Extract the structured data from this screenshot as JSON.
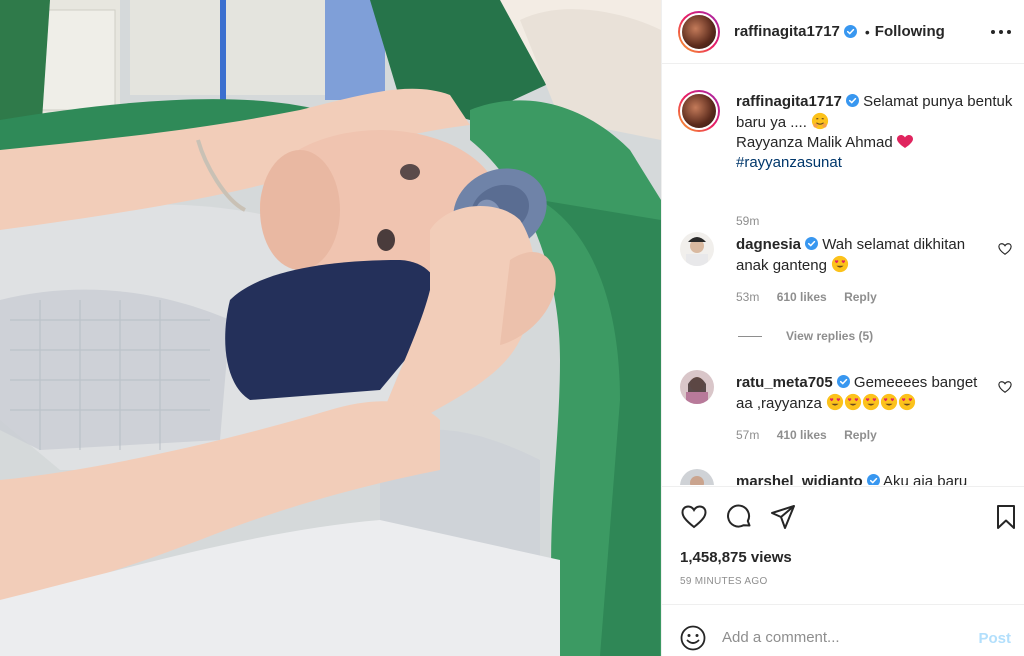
{
  "post": {
    "author": "raffinagita1717",
    "follow_status": "Following",
    "caption_line1": "Selamat punya bentuk baru ya .... ",
    "caption_line2": "Rayyanza Malik Ahmad ",
    "caption_hashtag": "#rayyanzasunat",
    "caption_time": "59m"
  },
  "comments": [
    {
      "username": "dagnesia",
      "text": "Wah selamat dikhitan anak ganteng ",
      "time": "53m",
      "likes": "610 likes",
      "reply": "Reply",
      "view_replies": "View replies (5)"
    },
    {
      "username": "ratu_meta705",
      "text": "Gemeeees banget aa ,rayyanza ",
      "time": "57m",
      "likes": "410 likes",
      "reply": "Reply"
    },
    {
      "username": "marshel_widianto",
      "text": "Aku aja baru"
    }
  ],
  "stats": {
    "views": "1,458,875 views",
    "posted_ago": "59 MINUTES AGO"
  },
  "comment_box": {
    "placeholder": "Add a comment...",
    "post_label": "Post"
  },
  "icons": [
    "more-icon",
    "verified-icon",
    "heart-icon",
    "comment-icon",
    "share-icon",
    "bookmark-icon",
    "emoji-icon"
  ],
  "colors": {
    "verified": "#3897f0",
    "link": "#00376b",
    "muted": "#8e8e8e",
    "post_disabled": "#b2dffc"
  }
}
